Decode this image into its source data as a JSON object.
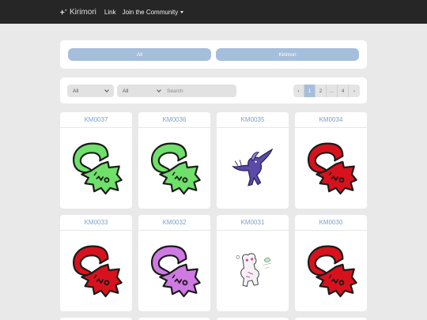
{
  "navbar": {
    "brand": "Kirimori",
    "link": "Link",
    "community": "Join the Community"
  },
  "filters": {
    "owner_all": "All",
    "owner_kirimori": "Kirimori",
    "select1": "All",
    "select2": "All",
    "search_placeholder": "Search"
  },
  "pagination": {
    "prev": "‹",
    "pages": [
      "1",
      "2",
      "...",
      "4"
    ],
    "active": "1",
    "next": "›"
  },
  "colors": {
    "green": "#6fe06a",
    "red": "#d8121d",
    "purple": "#cf7ae2",
    "accent": "#a5bedc",
    "code": "#7aa1cb"
  },
  "cards": [
    {
      "code": "KM0037",
      "art": "emblem",
      "color": "green"
    },
    {
      "code": "KM0036",
      "art": "emblem",
      "color": "green"
    },
    {
      "code": "KM0035",
      "art": "bird-character"
    },
    {
      "code": "KM0034",
      "art": "emblem",
      "color": "red"
    },
    {
      "code": "KM0033",
      "art": "emblem",
      "color": "red"
    },
    {
      "code": "KM0032",
      "art": "emblem",
      "color": "purple"
    },
    {
      "code": "KM0031",
      "art": "sketch-character"
    },
    {
      "code": "KM0030",
      "art": "emblem",
      "color": "red"
    }
  ]
}
